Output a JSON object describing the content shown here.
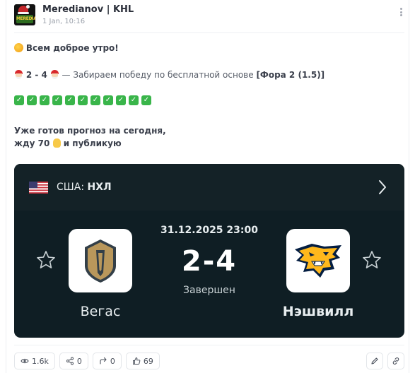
{
  "post": {
    "channel_name": "Meredianov | KHL",
    "date": "1 Jan, 10:16",
    "avatar_label": "MEREDIANOV"
  },
  "body": {
    "greeting": "Всем доброе утро!",
    "score_result": "2 - 4",
    "score_text": " — Забираем победу по бесплатной основе ",
    "bet_label": "[Фора 2 (1.5)]",
    "checks": [
      "✓",
      "✓",
      "✓",
      "✓",
      "✓",
      "✓",
      "✓",
      "✓",
      "✓",
      "✓",
      "✓"
    ],
    "ready_line": "Уже готов прогноз на сегодня,",
    "wait_prefix": "жду 70",
    "wait_suffix": " и публикую"
  },
  "match": {
    "country": "США:",
    "league": "НХЛ",
    "datetime": "31.12.2025 23:00",
    "score": "2-4",
    "status": "Завершен",
    "home_team": "Вегас",
    "away_team": "Нэшвилл"
  },
  "footer": {
    "views": "1.6k",
    "shares": "0",
    "forwards": "0",
    "likes": "69"
  },
  "colors": {
    "card_bg": "#0f1e24",
    "check_green": "#39b54a",
    "vegas_gold": "#b9975b",
    "preds_gold": "#ffb81c",
    "preds_navy": "#041e42"
  },
  "icons": {
    "views": "eye-icon",
    "shares": "share-icon",
    "forwards": "forward-icon",
    "likes": "thumbs-up-icon",
    "edit": "pencil-icon",
    "link": "link-icon"
  }
}
